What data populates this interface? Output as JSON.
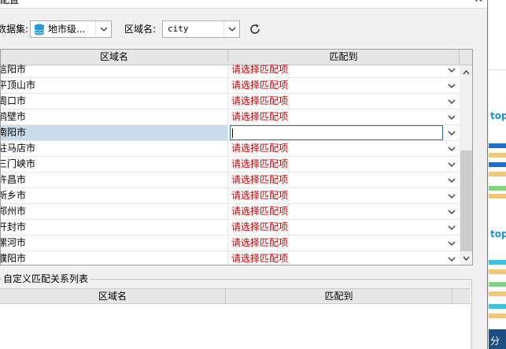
{
  "dialog": {
    "title": "配置",
    "close_symbol": "✕"
  },
  "toolbar": {
    "dataset_label": "数据集:",
    "dataset_value": "地市级...",
    "area_label": "区域名:",
    "area_value": "city"
  },
  "top_table": {
    "columns": [
      "区域名",
      "匹配到"
    ],
    "placeholder": "请选择匹配项",
    "rows": [
      {
        "name": "信阳市",
        "match": "请选择匹配项"
      },
      {
        "name": "平顶山市",
        "match": "请选择匹配项"
      },
      {
        "name": "周口市",
        "match": "请选择匹配项"
      },
      {
        "name": "鹤壁市",
        "match": "请选择匹配项"
      },
      {
        "name": "南阳市",
        "match": ""
      },
      {
        "name": "驻马店市",
        "match": "请选择匹配项"
      },
      {
        "name": "三门峡市",
        "match": "请选择匹配项"
      },
      {
        "name": "许昌市",
        "match": "请选择匹配项"
      },
      {
        "name": "新乡市",
        "match": "请选择匹配项"
      },
      {
        "name": "郑州市",
        "match": "请选择匹配项"
      },
      {
        "name": "开封市",
        "match": "请选择匹配项"
      },
      {
        "name": "漯河市",
        "match": "请选择匹配项"
      },
      {
        "name": "濮阳市",
        "match": "请选择匹配项"
      }
    ]
  },
  "custom_group": {
    "title": "自定义匹配关系列表",
    "columns": [
      "区域名",
      "匹配到"
    ]
  },
  "background_app": {
    "word1": "top",
    "word2": "top",
    "word3": "分"
  },
  "colors": {
    "placeholder_red": "#cc0000",
    "selection": "#c9dcec",
    "accent_blue": "#1a94d6"
  }
}
